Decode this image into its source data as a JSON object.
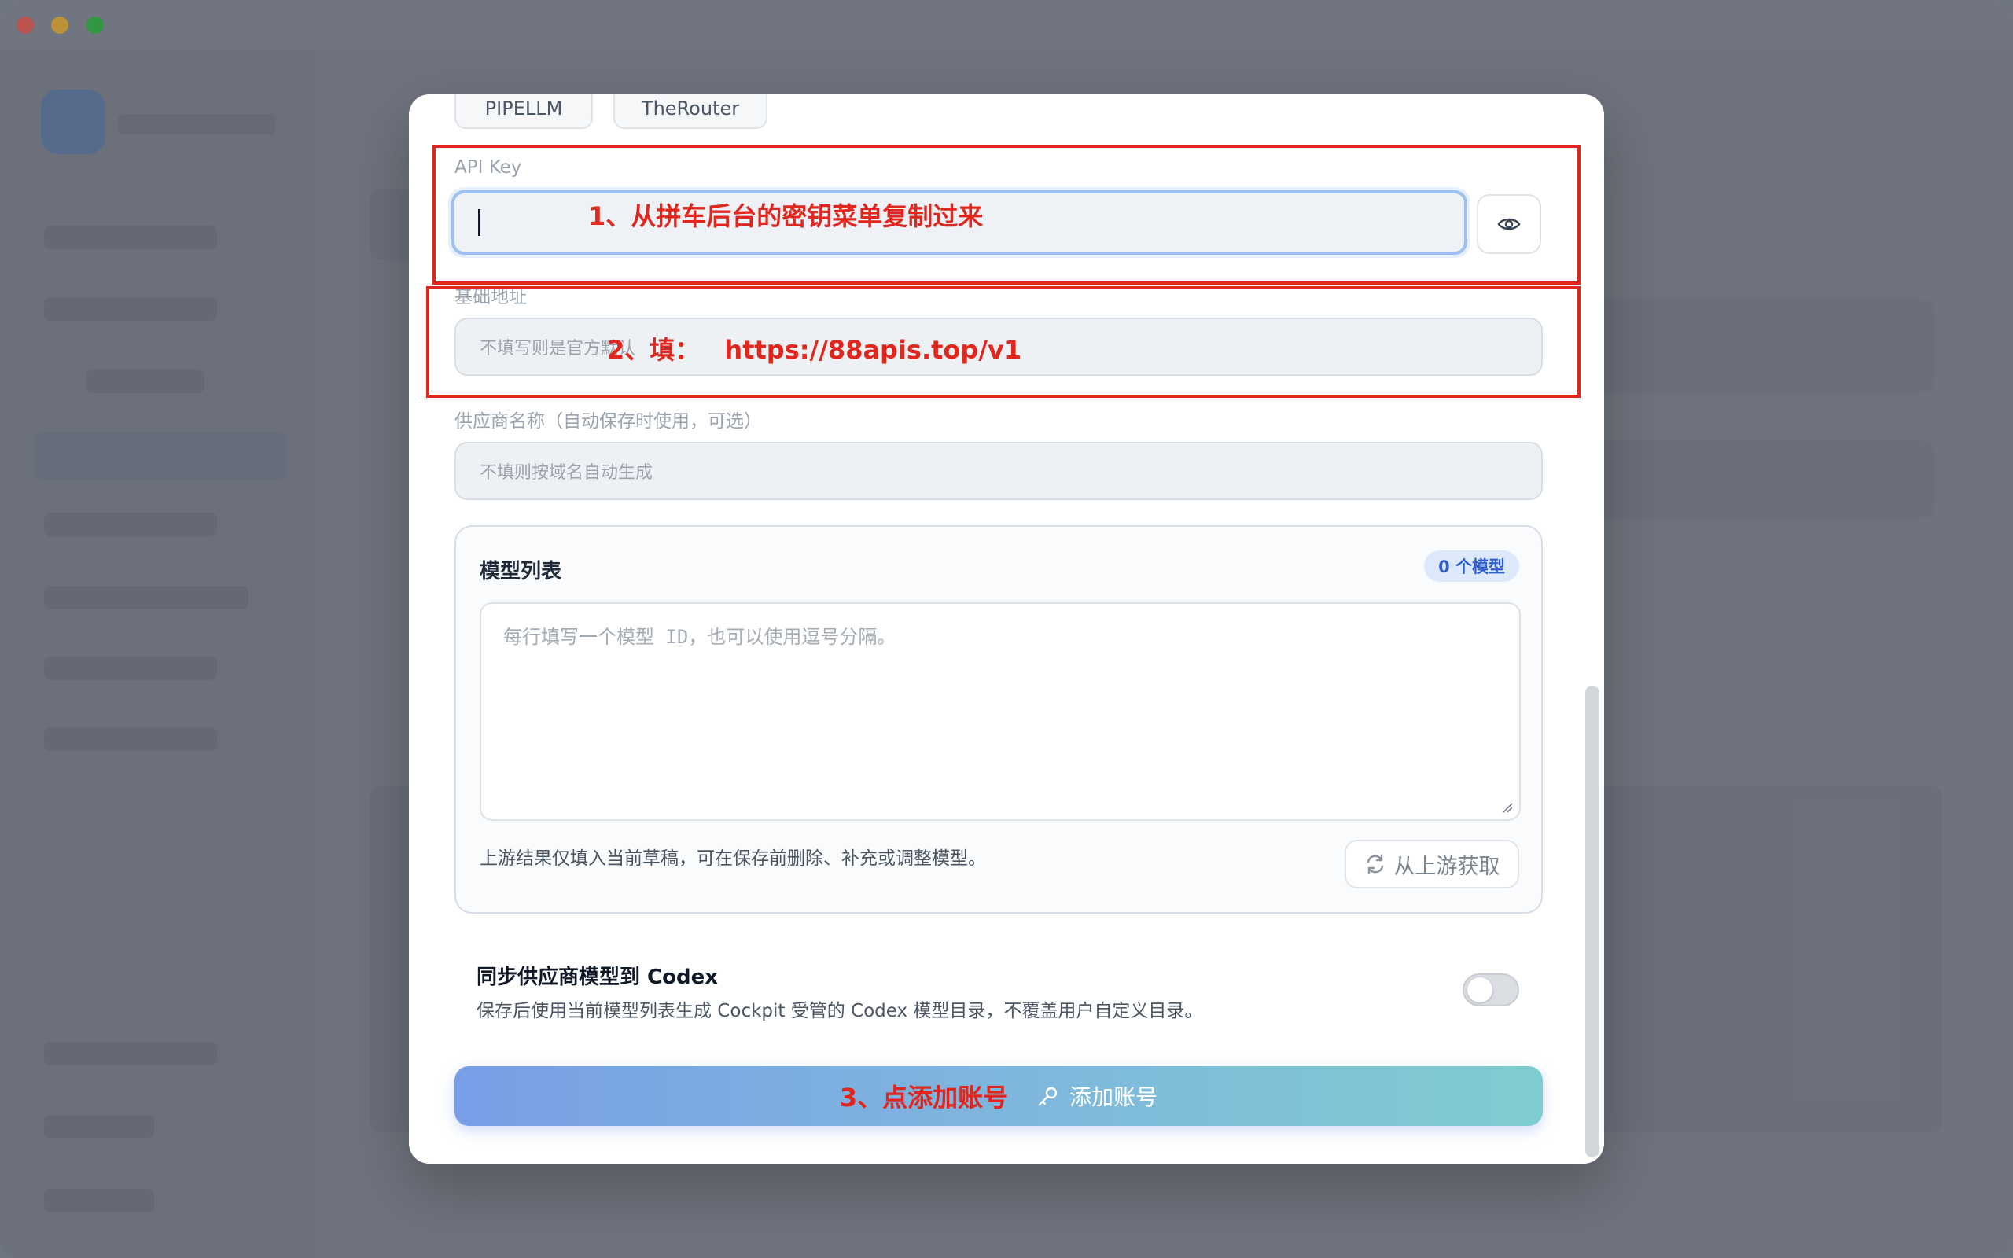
{
  "chips": [
    "PIPELLM",
    "TheRouter"
  ],
  "api_key": {
    "label": "API Key",
    "value": "",
    "annotation": "1、从拼车后台的密钥菜单复制过来",
    "eye_icon": "eye-icon"
  },
  "base_url": {
    "label": "基础地址",
    "placeholder": "不填写则是官方默认",
    "annotation_prefix": "2、填：",
    "annotation_url": "https://88apis.top/v1"
  },
  "provider_name": {
    "label": "供应商名称（自动保存时使用，可选）",
    "placeholder": "不填则按域名自动生成"
  },
  "models": {
    "title": "模型列表",
    "badge": "0 个模型",
    "placeholder": "每行填写一个模型 ID，也可以使用逗号分隔。",
    "hint": "上游结果仅填入当前草稿，可在保存前删除、补充或调整模型。",
    "fetch_label": "从上游获取",
    "fetch_icon": "refresh-icon"
  },
  "sync": {
    "title": "同步供应商模型到 Codex",
    "description": "保存后使用当前模型列表生成 Cockpit 受管的 Codex 模型目录，不覆盖用户自定义目录。",
    "enabled": false
  },
  "submit": {
    "annotation": "3、点添加账号",
    "label": "添加账号",
    "icon": "key-icon"
  },
  "colors": {
    "annotation": "#e0261d",
    "focus_ring": "#9ec0f0",
    "badge_text": "#2f5fcf"
  }
}
